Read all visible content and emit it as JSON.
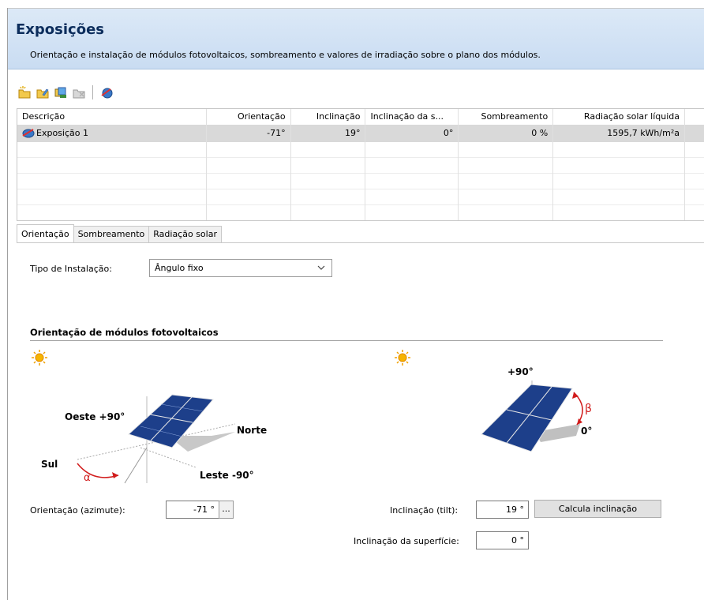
{
  "header": {
    "title": "Exposições",
    "subtitle": "Orientação e instalação de módulos fotovoltaicos, sombreamento e valores de irradiação sobre o plano dos módulos."
  },
  "toolbar": {
    "icons": [
      "new-folder-icon",
      "edit-folder-icon",
      "copy-icon",
      "delete-icon",
      "orientation-icon"
    ]
  },
  "table": {
    "columns": [
      "Descrição",
      "Orientação",
      "Inclinação",
      "Inclinação da s...",
      "Sombreamento",
      "Radiação solar líquida"
    ],
    "rows": [
      [
        "Exposição 1",
        "-71°",
        "19°",
        "0°",
        "0 %",
        "1595,7 kWh/m²a"
      ]
    ]
  },
  "tabs": [
    "Orientação",
    "Sombreamento",
    "Radiação solar"
  ],
  "active_tab": "Orientação",
  "installation": {
    "label": "Tipo de Instalação:",
    "value": "Ângulo fixo"
  },
  "section": {
    "title": "Orientação de módulos fotovoltaicos"
  },
  "diagram_azimuth": {
    "west": "Oeste +90°",
    "north": "Norte",
    "south": "Sul",
    "east": "Leste -90°",
    "angle": "α"
  },
  "diagram_tilt": {
    "top": "+90°",
    "bottom": "0°",
    "angle": "β"
  },
  "fields": {
    "azimuth_label": "Orientação (azimute):",
    "azimuth_value": "-71 °",
    "azimuth_button": "...",
    "tilt_label": "Inclinação (tilt):",
    "tilt_value": "19 °",
    "calc_button": "Calcula inclinação",
    "surface_label": "Inclinação da superfície:",
    "surface_value": "0 °"
  },
  "colors": {
    "header_bg": "#c9dcf2",
    "title": "#0c2d5c",
    "selected_row": "#d9d9d9",
    "angle_red": "#d11c1c"
  }
}
